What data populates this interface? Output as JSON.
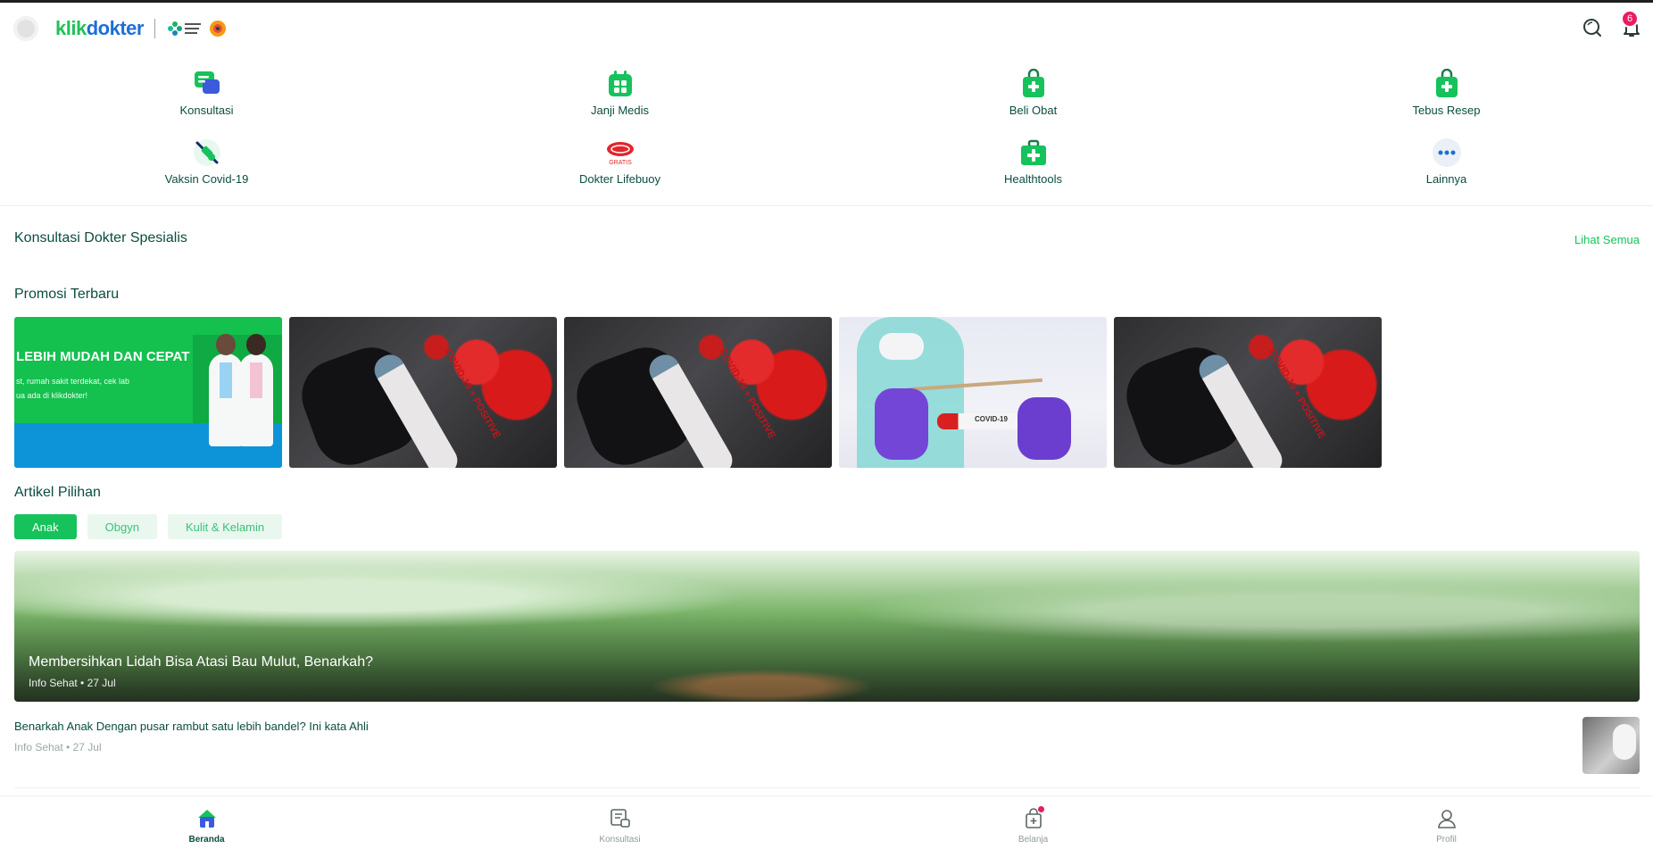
{
  "header": {
    "logo_part1": "klik",
    "logo_part2": "dokter",
    "notification_count": "6"
  },
  "menu": [
    {
      "label": "Konsultasi",
      "icon": "chat-bubble-icon"
    },
    {
      "label": "Janji Medis",
      "icon": "calendar-icon"
    },
    {
      "label": "Beli Obat",
      "icon": "medicine-bag-icon"
    },
    {
      "label": "Tebus Resep",
      "icon": "prescription-bag-icon"
    },
    {
      "label": "Vaksin Covid-19",
      "icon": "syringe-icon"
    },
    {
      "label": "Dokter Lifebuoy",
      "icon": "lifebuoy-logo-icon",
      "badge_text": "GRATIS"
    },
    {
      "label": "Healthtools",
      "icon": "first-aid-kit-icon"
    },
    {
      "label": "Lainnya",
      "icon": "more-dots-icon"
    }
  ],
  "specialist_section": {
    "title": "Konsultasi Dokter Spesialis",
    "see_all": "Lihat Semua"
  },
  "promo_section": {
    "title": "Promosi Terbaru",
    "banner_headline": "LEBIH MUDAH DAN CEPAT",
    "banner_sub1": "st, rumah sakit terdekat, cek lab",
    "banner_sub2": "ua ada di klikdokter!",
    "covid_label": "COVID-19 + POSITIVE",
    "swab_label": "COVID-19"
  },
  "articles_section": {
    "title": "Artikel Pilihan",
    "tabs": [
      "Anak",
      "Obgyn",
      "Kulit & Kelamin"
    ],
    "active_tab": "Anak",
    "featured": {
      "title": "Membersihkan Lidah Bisa Atasi Bau Mulut, Benarkah?",
      "category": "Info Sehat",
      "date": "27 Jul"
    },
    "items": [
      {
        "title": "Benarkah Anak Dengan pusar rambut satu lebih bandel? Ini kata Ahli",
        "category": "Info Sehat",
        "date": "27 Jul"
      }
    ]
  },
  "bottom_nav": [
    {
      "label": "Beranda",
      "icon": "home-icon",
      "active": true
    },
    {
      "label": "Konsultasi",
      "icon": "consult-icon",
      "active": false
    },
    {
      "label": "Belanja",
      "icon": "shopping-bag-icon",
      "active": false
    },
    {
      "label": "Profil",
      "icon": "profile-icon",
      "active": false
    }
  ],
  "colors": {
    "brand_green": "#16c25b",
    "brand_blue": "#1b6fd6",
    "text_dark": "#0b4d3f",
    "badge_pink": "#ea1a63"
  }
}
